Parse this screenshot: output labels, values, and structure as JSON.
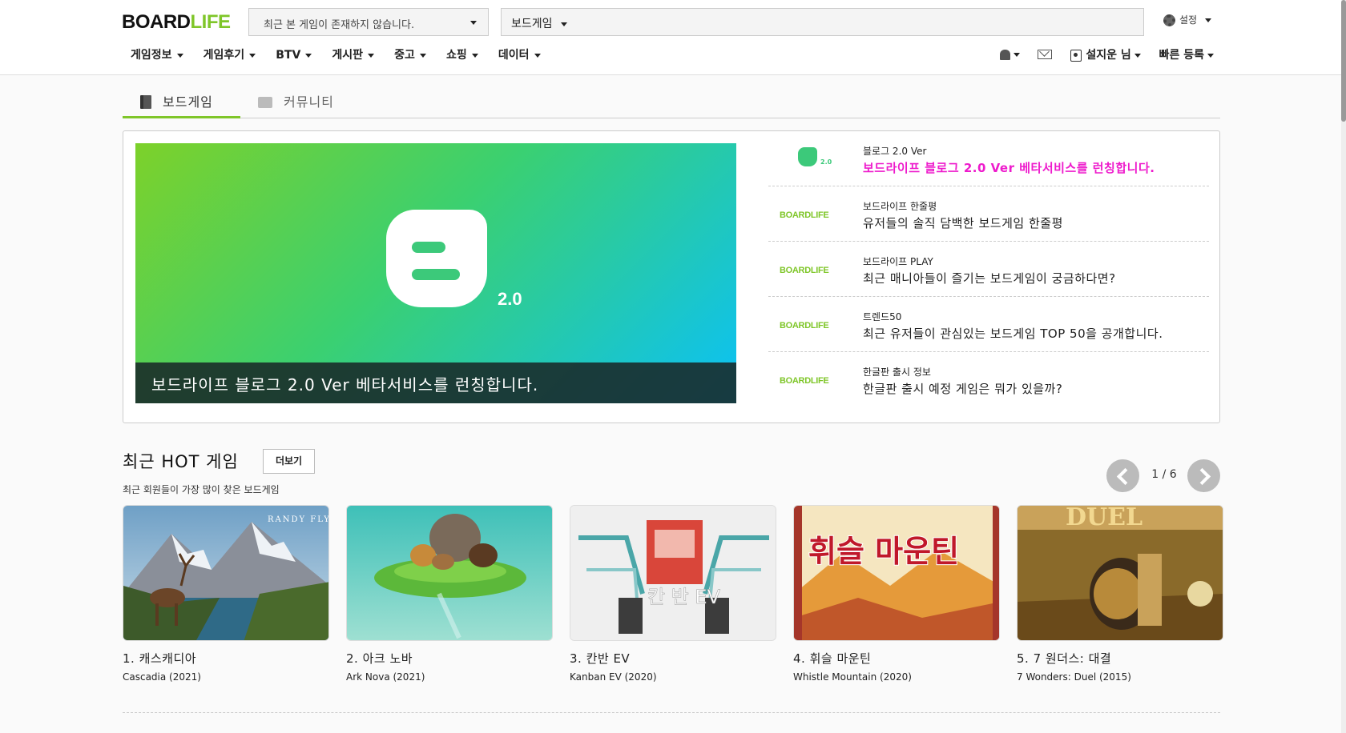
{
  "header": {
    "logo_board": "BOARD",
    "logo_life": "LIFE",
    "recent_games": "최근 본 게임이 존재하지 않습니다.",
    "search_category": "보드게임",
    "settings_label": "설정"
  },
  "nav": {
    "items": [
      "게임정보",
      "게임후기",
      "BTV",
      "게시판",
      "중고",
      "쇼핑",
      "데이터"
    ],
    "user_label": "설지운 님",
    "quick_register": "빠른 등록"
  },
  "tabs": [
    "보드게임",
    "커뮤니티"
  ],
  "banner": {
    "version_text": "2.0",
    "caption": "보드라이프 블로그 2.0 Ver 베타서비스를 런칭합니다."
  },
  "news": [
    {
      "thumb": "2.0",
      "category": "블로그 2.0 Ver",
      "title": "보드라이프 블로그 2.0 Ver 베타서비스를 런칭합니다.",
      "highlight": true
    },
    {
      "thumb": "BOARDLIFE",
      "category": "보드라이프 한줄평",
      "title": "유저들의 솔직 담백한 보드게임 한줄평",
      "highlight": false
    },
    {
      "thumb": "BOARDLIFE",
      "category": "보드라이프 PLAY",
      "title": "최근 매니아들이 즐기는 보드게임이 궁금하다면?",
      "highlight": false
    },
    {
      "thumb": "BOARDLIFE",
      "category": "트렌드50",
      "title": "최근 유저들이 관심있는 보드게임 TOP 50을 공개합니다.",
      "highlight": false
    },
    {
      "thumb": "BOARDLIFE",
      "category": "한글판 출시 정보",
      "title": "한글판 출시 예정 게임은 뭐가 있을까?",
      "highlight": false
    }
  ],
  "hot": {
    "title": "최근 HOT 게임",
    "more_label": "더보기",
    "subtitle": "최근 회원들이 가장 많이 찾은 보드게임",
    "page_indicator": "1 / 6",
    "games": [
      {
        "title": "1. 캐스캐디아",
        "subtitle": "Cascadia  (2021)",
        "cover_text": "RANDY FLYNN"
      },
      {
        "title": "2. 아크 노바",
        "subtitle": "Ark Nova  (2021)",
        "cover_text": ""
      },
      {
        "title": "3. 칸반 EV",
        "subtitle": "Kanban EV  (2020)",
        "cover_text": "칸 반 EV"
      },
      {
        "title": "4. 휘슬 마운틴",
        "subtitle": "Whistle Mountain  (2020)",
        "cover_text": "휘슬 마운틴"
      },
      {
        "title": "5. 7 원더스: 대결",
        "subtitle": "7 Wonders: Duel  (2015)",
        "cover_text": "DUEL"
      }
    ]
  },
  "colors": {
    "brand_green": "#7fc629",
    "highlight_magenta": "#ee1bcc"
  }
}
